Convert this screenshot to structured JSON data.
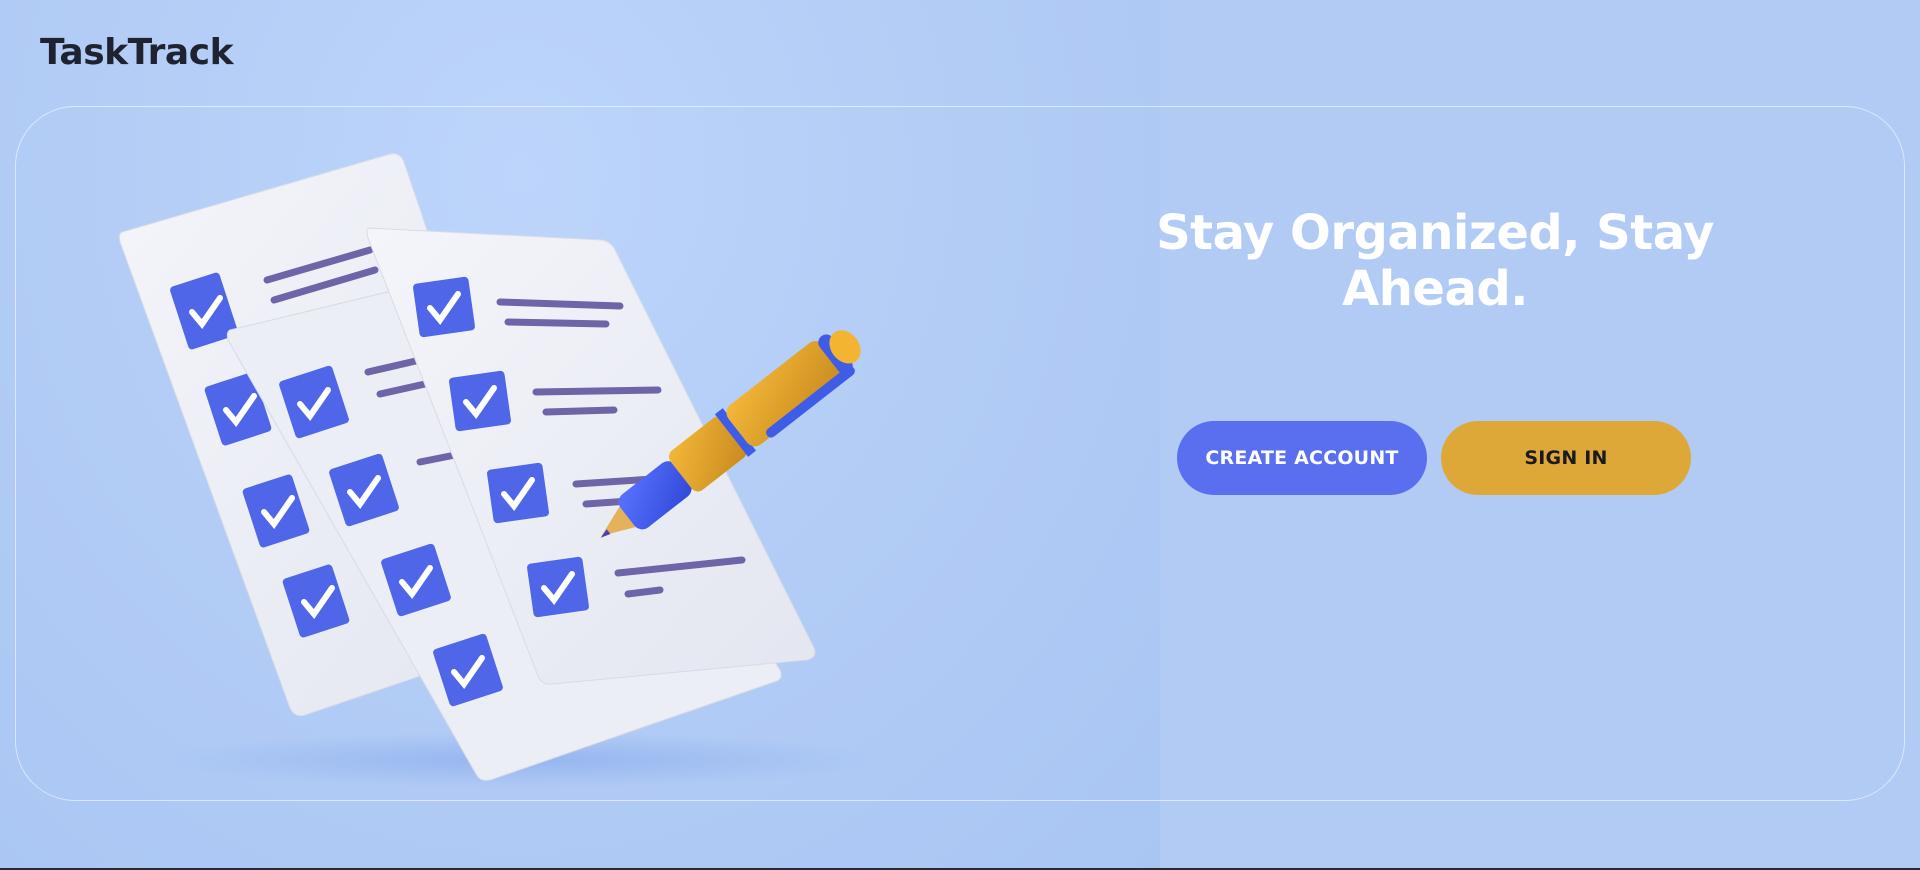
{
  "app": {
    "name": "TaskTrack"
  },
  "hero": {
    "headline": "Stay Organized, Stay Ahead.",
    "illustration_icon": "checklist-with-pen-illustration"
  },
  "actions": {
    "create_account_label": "CREATE ACCOUNT",
    "sign_in_label": "SIGN IN"
  },
  "colors": {
    "background": "#b1cbf4",
    "primary_button": "#5a6ff0",
    "secondary_button": "#dea838",
    "checkbox": "#4f66e8",
    "headline": "#ffffff",
    "logo": "#1f2230"
  }
}
